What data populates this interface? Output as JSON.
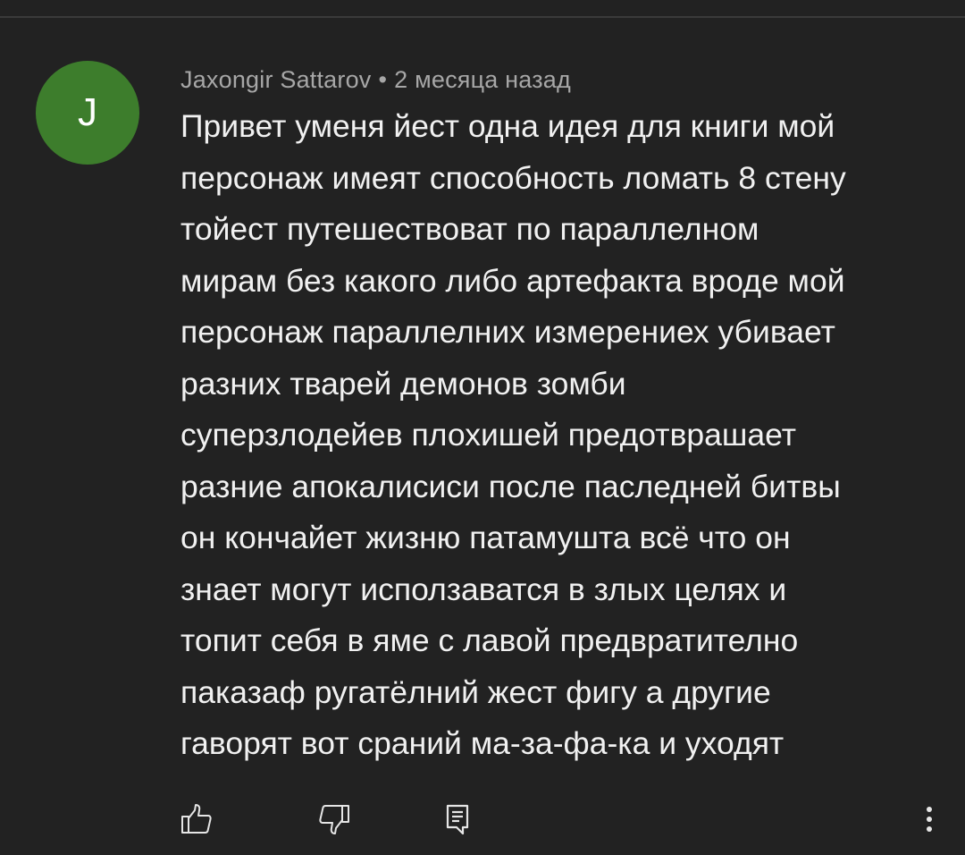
{
  "comment": {
    "avatar_letter": "J",
    "author": "Jaxongir Sattarov",
    "separator": "•",
    "timestamp": "2 месяца назад",
    "lines": [
      "Привет уменя йест одна идея для книги мой",
      "персонаж имеят способность ломать 8 стену",
      "тойест путешествоват по параллелном",
      "мирам без какого либо артефакта вроде мой",
      "персонаж параллелних измерениех убивает",
      "разних тварей демонов зомби",
      "суперзлодейев плохишей предотврашает",
      "разние апокалисиси после паследней битвы",
      "он кончайет жизню патамушта всё что он",
      "знает могут исползаватся в злых целях и",
      "топит себя в яме с лавой предвратително",
      "паказаф ругатёлний жест фигу а другие",
      "гаворят вот сраний ма-за-фа-ка и уходят"
    ]
  },
  "actions": {
    "like_icon": "thumb-up-icon",
    "dislike_icon": "thumb-down-icon",
    "reply_icon": "reply-comment-icon",
    "menu_icon": "more-vertical-icon"
  },
  "colors": {
    "background": "#222222",
    "avatar": "#3d7d2c",
    "text": "#f1f1f1",
    "meta": "#a7a7a7",
    "icon": "#e6e6e6"
  }
}
